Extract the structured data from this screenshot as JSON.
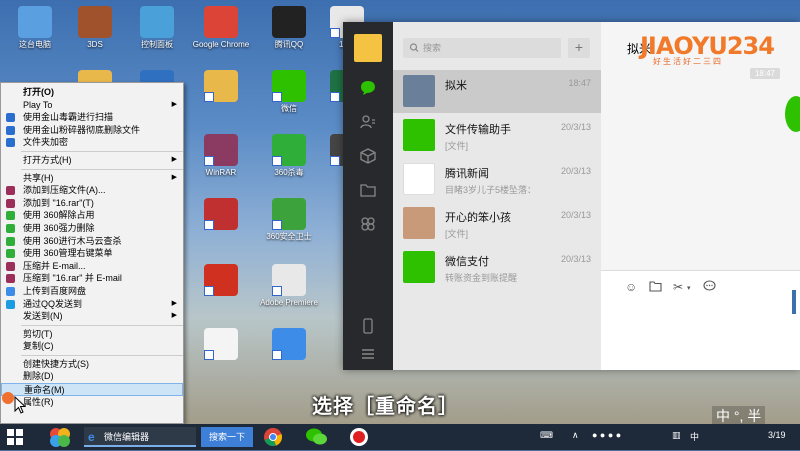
{
  "desktop_icons": [
    {
      "id": "this-pc",
      "label": "这台电脑",
      "color": "#5aa0e0"
    },
    {
      "id": "library",
      "label": "3DS",
      "color": "#a0522d"
    },
    {
      "id": "control-panel",
      "label": "控制面板",
      "color": "#4aa0d8"
    },
    {
      "id": "chrome",
      "label": "Google Chrome",
      "color": "#db4437"
    },
    {
      "id": "qq",
      "label": "腾讯QQ",
      "color": "#222"
    },
    {
      "id": "file-1111",
      "label": "1111",
      "color": "#e8e8e8"
    },
    {
      "id": "folder-a",
      "label": "",
      "color": "#e8b84a"
    },
    {
      "id": "folder-b",
      "label": "",
      "color": "#e8b84a"
    },
    {
      "id": "wechat-shortcut",
      "label": "微信",
      "color": "#2dc100"
    },
    {
      "id": "excel",
      "label": "",
      "color": "#1e7145"
    },
    {
      "id": "wubi",
      "label": "",
      "color": "#3070c0"
    },
    {
      "id": "winrar",
      "label": "WinRAR",
      "color": "#8b3a62"
    },
    {
      "id": "360-antivirus",
      "label": "360杀毒",
      "color": "#2fae3a"
    },
    {
      "id": "bandicam",
      "label": "",
      "color": "#444"
    },
    {
      "id": "game",
      "label": "",
      "color": "#c03030"
    },
    {
      "id": "360-security",
      "label": "360安全卫士",
      "color": "#3ca33c"
    },
    {
      "id": "jingling",
      "label": "",
      "color": "#d03020"
    },
    {
      "id": "premiere",
      "label": "Adobe Premiere",
      "color": "#e8e8e8"
    },
    {
      "id": "shimo",
      "label": "",
      "color": "#f4f4f4"
    },
    {
      "id": "baidu-pan",
      "label": "",
      "color": "#3d8de8"
    }
  ],
  "context_menu": {
    "items": [
      {
        "label": "打开(O)",
        "bold": true
      },
      {
        "label": "Play To",
        "arrow": true
      },
      {
        "label": "使用金山毒霸进行扫描",
        "icon": "#2a6fd0"
      },
      {
        "label": "使用金山粉碎器彻底删除文件",
        "icon": "#2a6fd0"
      },
      {
        "label": "文件夹加密",
        "icon": "#2a6fd0"
      },
      {
        "sep": true
      },
      {
        "label": "打开方式(H)",
        "arrow": true
      },
      {
        "sep": true
      },
      {
        "label": "共享(H)",
        "arrow": true
      },
      {
        "label": "添加到压缩文件(A)...",
        "icon": "#9b2f5a"
      },
      {
        "label": "添加到 \"16.rar\"(T)",
        "icon": "#9b2f5a"
      },
      {
        "label": "使用 360解除占用",
        "icon": "#2fae3a"
      },
      {
        "label": "使用 360强力删除",
        "icon": "#2fae3a"
      },
      {
        "label": "使用 360进行木马云查杀",
        "icon": "#2fae3a"
      },
      {
        "label": "使用 360管理右键菜单",
        "icon": "#2fae3a"
      },
      {
        "label": "压缩并 E-mail...",
        "icon": "#9b2f5a"
      },
      {
        "label": "压缩到 \"16.rar\" 并 E-mail",
        "icon": "#9b2f5a"
      },
      {
        "label": "上传到百度网盘",
        "icon": "#3d8de8"
      },
      {
        "label": "通过QQ发送到",
        "arrow": true,
        "icon": "#1b9be0"
      },
      {
        "label": "发送到(N)",
        "arrow": true
      },
      {
        "sep": true
      },
      {
        "label": "剪切(T)"
      },
      {
        "label": "复制(C)"
      },
      {
        "sep": true
      },
      {
        "label": "创建快捷方式(S)"
      },
      {
        "label": "删除(D)"
      },
      {
        "label": "重命名(M)",
        "highlight": true
      },
      {
        "label": "属性(R)"
      }
    ]
  },
  "wechat": {
    "search_placeholder": "搜索",
    "plus_label": "+",
    "conversations": [
      {
        "name": "拟米",
        "time": "18:47",
        "preview": "",
        "avatar": "#6a7f99",
        "selected": true
      },
      {
        "name": "文件传输助手",
        "time": "20/3/13",
        "preview": "[文件]",
        "avatar": "#2dc100"
      },
      {
        "name": "腾讯新闻",
        "time": "20/3/13",
        "preview": "目睹3岁儿子5楼坠落：",
        "avatar": "#ffffff"
      },
      {
        "name": "开心的笨小孩",
        "time": "20/3/13",
        "preview": "[文件]",
        "avatar": "#c89a7a"
      },
      {
        "name": "微信支付",
        "time": "20/3/13",
        "preview": "转账资金到账提醒",
        "avatar": "#2dc100"
      }
    ],
    "chat_title": "拟米",
    "chat_time": "18:47"
  },
  "watermark": {
    "logo": "JIAOYU234",
    "slogan": "好生活好二三四"
  },
  "subtitle": "选择［重命名］",
  "ime": "中 °, 半",
  "taskbar": {
    "editor_label": "微信编辑器",
    "search_label": "搜索一下",
    "clock": "3/19"
  }
}
